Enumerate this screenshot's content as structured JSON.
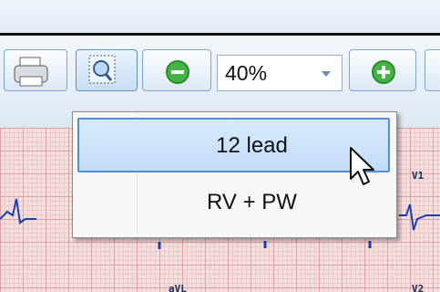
{
  "toolbar": {
    "zoom": {
      "value": "40%"
    },
    "buttons": [
      {
        "icon": "printer-icon"
      },
      {
        "icon": "zoom-select-icon",
        "active": true
      },
      {
        "icon": "zoom-out-icon"
      },
      {
        "icon": "zoom-in-icon"
      }
    ]
  },
  "layout_menu": {
    "items": [
      {
        "label": "12 lead",
        "highlighted": true
      },
      {
        "label": "RV + PW",
        "highlighted": false
      }
    ]
  },
  "ecg": {
    "lead_labels": [
      "V1",
      "aVL",
      "V2"
    ]
  },
  "colors": {
    "accent": "#4f8fd6",
    "grid": "#d6828c",
    "trace": "#1a3fb0"
  }
}
